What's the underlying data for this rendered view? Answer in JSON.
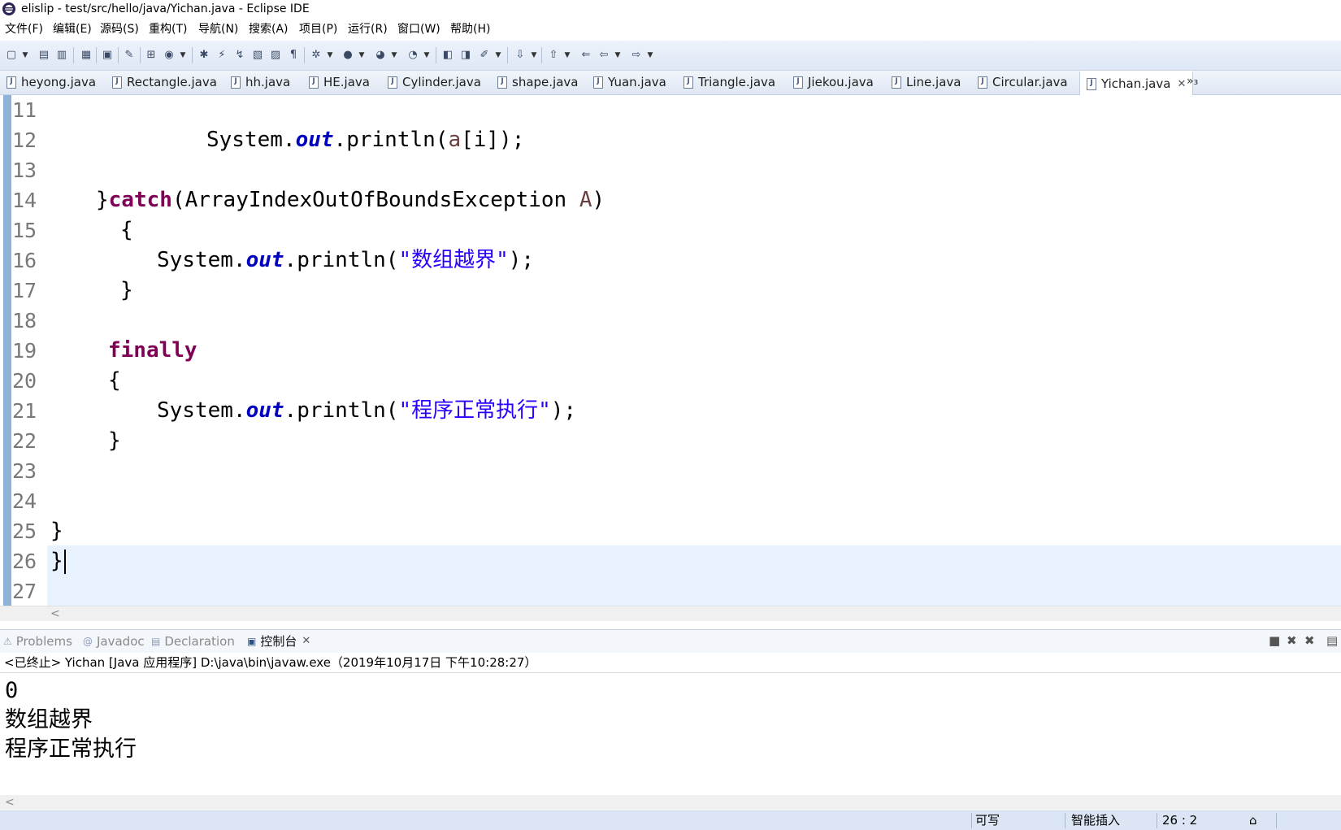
{
  "window": {
    "title": "elislip - test/src/hello/java/Yichan.java - Eclipse IDE"
  },
  "menu": [
    "文件(F)",
    "编辑(E)",
    "源码(S)",
    "重构(T)",
    "导航(N)",
    "搜索(A)",
    "项目(P)",
    "运行(R)",
    "窗口(W)",
    "帮助(H)"
  ],
  "editor_tabs": {
    "items": [
      "heyong.java",
      "Rectangle.java",
      "hh.java",
      "HE.java",
      "Cylinder.java",
      "shape.java",
      "Yuan.java",
      "Triangle.java",
      "Jiekou.java",
      "Line.java",
      "Circular.java",
      "Yichan.java"
    ],
    "active": "Yichan.java",
    "close_glyph": "✕",
    "more": "»₃"
  },
  "editor": {
    "line_numbers": [
      "11",
      "12",
      "13",
      "14",
      "15",
      "16",
      "17",
      "18",
      "19",
      "20",
      "21",
      "22",
      "23",
      "24",
      "25",
      "26",
      "27"
    ],
    "code": {
      "l12": {
        "cls": "System.",
        "field": "out",
        "rest1": ".println(",
        "var": "a",
        "rest2": "[i]);"
      },
      "l14": {
        "brace": "}",
        "kw": "catch",
        "rest1": "(ArrayIndexOutOfBoundsException ",
        "var": "A",
        "rest2": ")"
      },
      "l15": "{",
      "l16": {
        "cls": "System.",
        "field": "out",
        "rest1": ".println(",
        "str": "\"数组越界\"",
        "rest2": ");"
      },
      "l17": "}",
      "l19": {
        "kw": "finally"
      },
      "l20": "{",
      "l21": {
        "cls": "System.",
        "field": "out",
        "rest1": ".println(",
        "str": "\"程序正常执行\"",
        "rest2": ");"
      },
      "l22": "}",
      "l25": "}",
      "l26": "}"
    }
  },
  "bottom_panel": {
    "tabs": [
      "Problems",
      "Javadoc",
      "Declaration",
      "控制台"
    ],
    "active": "控制台",
    "close_glyph": "✕",
    "console_header": "<已终止> Yichan [Java 应用程序] D:\\java\\bin\\javaw.exe（2019年10月17日 下午10:28:27）",
    "output": [
      "0",
      "数组越界",
      "程序正常执行"
    ]
  },
  "status_bar": {
    "writable": "可写",
    "insert_mode": "智能插入",
    "position": "26 : 2"
  }
}
